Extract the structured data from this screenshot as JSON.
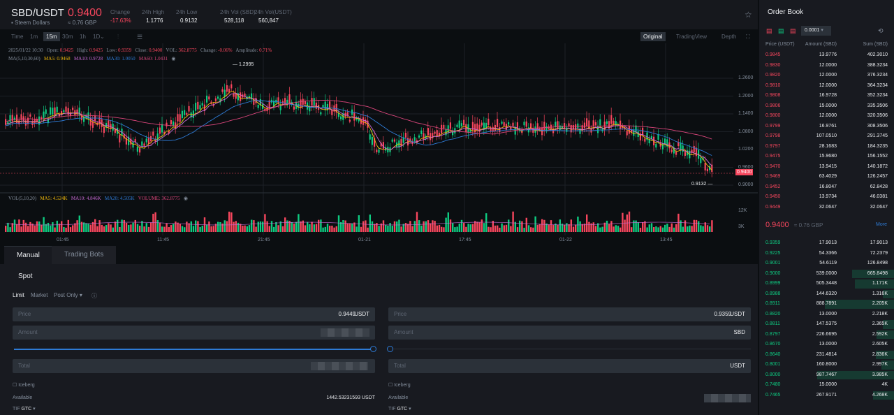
{
  "header": {
    "pair": "SBD/USDT",
    "name": "Steem Dollars",
    "price": "0.9400",
    "fiat": "≈ 0.76 GBP",
    "stats": [
      {
        "label": "Change",
        "value": "-17.63%",
        "tone": "red"
      },
      {
        "label": "24h High",
        "value": "1.1776",
        "tone": "white"
      },
      {
        "label": "24h Low",
        "value": "0.9132",
        "tone": "white"
      },
      {
        "label": "24h Vol (SBD)",
        "value": "528,118",
        "tone": "white"
      },
      {
        "label": "24h Vol(USDT)",
        "value": "560,847",
        "tone": "white"
      }
    ]
  },
  "toolbar": {
    "intervals": [
      "Time",
      "1m",
      "15m",
      "30m",
      "1h",
      "1D"
    ],
    "active": "15m",
    "views": [
      "Original",
      "TradingView",
      "Depth"
    ]
  },
  "chart": {
    "info": {
      "date": "2025/01/22 10:30",
      "open_l": "Open:",
      "open": "0.9425",
      "high_l": "High:",
      "high": "0.9425",
      "low_l": "Low:",
      "low": "0.9359",
      "close_l": "Close:",
      "close": "0.9400",
      "vol_l": "VOL:",
      "vol": "362.8775",
      "change_l": "Change:",
      "change": "-0.06%",
      "amp_l": "Amplitude:",
      "amp": "0.71%"
    },
    "ma": {
      "label": "MA(5,10,30,60)",
      "ma5": "MA5: 0.9468",
      "ma10": "MA10: 0.9728",
      "ma30": "MA30: 1.0050",
      "ma60": "MA60: 1.0431"
    },
    "vol_legend": {
      "label": "VOL(5,10,20)",
      "ma5": "MA5: 4.524K",
      "ma10": "MA10: 4.846K",
      "ma20": "MA20: 4.505K",
      "volume": "VOLUME: 362.8775"
    },
    "price_ticks": [
      "1.2600",
      "1.2000",
      "1.1400",
      "1.0800",
      "1.0200",
      "0.9600",
      "0.9000"
    ],
    "vol_ticks": [
      "12K",
      "3K"
    ],
    "time_ticks": [
      "01:45",
      "11:45",
      "21:45",
      "01-21",
      "17:45",
      "01-22",
      "13:45"
    ],
    "high_marker": "1.2995",
    "low_marker": "0.9132",
    "last_price": "0.9400"
  },
  "colors": {
    "up": "#0ecb81",
    "down": "#f6465d",
    "ma5": "#f0b90b",
    "ma10": "#c86bd6",
    "ma30": "#2e7bd6",
    "ma60": "#d8457a"
  },
  "tabs": {
    "manual": "Manual",
    "bots": "Trading Bots"
  },
  "form": {
    "section": "Spot",
    "types": [
      "Limit",
      "Market",
      "Post Only"
    ],
    "buy": {
      "price_label": "Price",
      "price": "0.9449",
      "price_unit": "USDT",
      "amount_label": "Amount",
      "total_label": "Total",
      "iceberg": "Iceberg",
      "available_label": "Available",
      "available": "1442.53231593 USDT",
      "tif_label": "TIF",
      "tif": "GTC"
    },
    "sell": {
      "price_label": "Price",
      "price": "0.9359",
      "price_unit": "USDT",
      "amount_label": "Amount",
      "amount_unit": "SBD",
      "total_label": "Total",
      "total_unit": "USDT",
      "iceberg": "Iceberg",
      "available_label": "Available",
      "tif_label": "TIF",
      "tif": "GTC"
    }
  },
  "orderbook": {
    "title": "Order Book",
    "precision": "0.0001",
    "headers": [
      "Price (USDT)",
      "Amount (SBD)",
      "Sum (SBD)"
    ],
    "asks": [
      [
        "0.9845",
        "13.9776",
        "402.3010"
      ],
      [
        "0.9830",
        "12.0000",
        "388.3234"
      ],
      [
        "0.9820",
        "12.0000",
        "376.3234"
      ],
      [
        "0.9810",
        "12.0000",
        "364.3234"
      ],
      [
        "0.9808",
        "16.9728",
        "352.3234"
      ],
      [
        "0.9806",
        "15.0000",
        "335.3506"
      ],
      [
        "0.9800",
        "12.0000",
        "320.3506"
      ],
      [
        "0.9799",
        "16.9761",
        "308.3506"
      ],
      [
        "0.9798",
        "107.0510",
        "291.3745"
      ],
      [
        "0.9797",
        "28.1683",
        "184.3235"
      ],
      [
        "0.9475",
        "15.9680",
        "156.1552"
      ],
      [
        "0.9470",
        "13.9415",
        "140.1872"
      ],
      [
        "0.9469",
        "63.4029",
        "126.2457"
      ],
      [
        "0.9452",
        "16.8047",
        "62.8428"
      ],
      [
        "0.9450",
        "13.9734",
        "46.0381"
      ],
      [
        "0.9449",
        "32.0647",
        "32.0647"
      ]
    ],
    "mid_price": "0.9400",
    "mid_fiat": "≈ 0.76 GBP",
    "more": "More",
    "bids": [
      [
        "0.9359",
        "17.9013",
        "17.9013"
      ],
      [
        "0.9225",
        "54.3366",
        "72.2379"
      ],
      [
        "0.9001",
        "54.6119",
        "126.8498"
      ],
      [
        "0.9000",
        "539.0000",
        "665.8498"
      ],
      [
        "0.8999",
        "505.3448",
        "1.171K"
      ],
      [
        "0.8988",
        "144.6320",
        "1.316K"
      ],
      [
        "0.8911",
        "888.7891",
        "2.205K"
      ],
      [
        "0.8820",
        "13.0000",
        "2.218K"
      ],
      [
        "0.8811",
        "147.5375",
        "2.365K"
      ],
      [
        "0.8797",
        "226.6695",
        "2.592K"
      ],
      [
        "0.8670",
        "13.0000",
        "2.605K"
      ],
      [
        "0.8640",
        "231.4814",
        "2.836K"
      ],
      [
        "0.8001",
        "160.8000",
        "2.997K"
      ],
      [
        "0.8000",
        "987.7467",
        "3.985K"
      ],
      [
        "0.7480",
        "15.0000",
        "4K"
      ],
      [
        "0.7465",
        "267.9171",
        "4.268K"
      ]
    ]
  }
}
